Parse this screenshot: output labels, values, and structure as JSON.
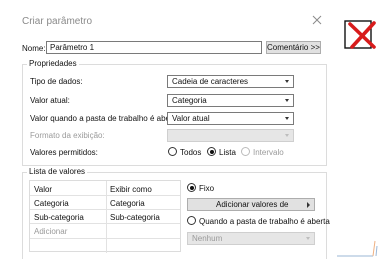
{
  "dialog": {
    "title": "Criar parâmetro",
    "name_label": "Nome:",
    "name_value": "Parâmetro 1",
    "comment_button": "Comentário >>"
  },
  "properties": {
    "group_label": "Propriedades",
    "data_type_label": "Tipo de dados:",
    "data_type_value": "Cadeia de caracteres",
    "current_value_label": "Valor atual:",
    "current_value": "Categoria",
    "workbook_open_label": "Valor quando a pasta de trabalho é aberta:",
    "workbook_open_value": "Valor atual",
    "display_format_label": "Formato da exibição:",
    "display_format_value": "",
    "allowed_values_label": "Valores permitidos:",
    "allowed_options": [
      "Todos",
      "Lista",
      "Intervalo"
    ],
    "allowed_selected": "Lista"
  },
  "value_list": {
    "group_label": "Lista de valores",
    "headers": [
      "Valor",
      "Exibir como"
    ],
    "rows": [
      [
        "Categoria",
        "Categoria"
      ],
      [
        "Sub-categoria",
        "Sub-categoria"
      ]
    ],
    "add_placeholder": "Adicionar",
    "fixed_label": "Fixo",
    "add_values_button": "Adicionar valores de",
    "workbook_open_option": "Quando a pasta de trabalho é aberta",
    "workbook_open_select": "Nenhum"
  },
  "colors": {
    "accent_red": "#d81b1b"
  },
  "icons": {
    "close": "close-icon",
    "red_x": "red-x-icon",
    "caret": "chevron-down-icon",
    "arrow": "arrow-right-icon"
  }
}
